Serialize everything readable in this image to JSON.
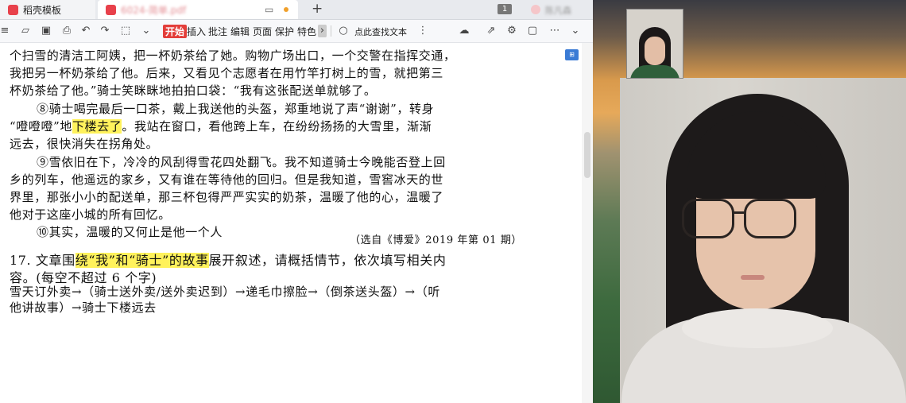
{
  "tabs": [
    {
      "label": "稻壳模板"
    },
    {
      "label": "6024-简单.pdf"
    }
  ],
  "tab_extras": {
    "page_badge": "1",
    "user_name": "陈凡森"
  },
  "toolbar": {
    "menus": [
      "开始",
      "插入",
      "批注",
      "编辑",
      "页面",
      "保护",
      "特色"
    ],
    "search_label": "点此查找文本"
  },
  "document": {
    "lines": [
      "个扫雪的清洁工阿姨，把一杯奶茶给了她。购物广场出口，一个交警在指挥交通，",
      "我把另一杯奶茶给了他。后来，又看见个志愿者在用竹竿打树上的雪，就把第三",
      "杯奶茶给了他。”骑士笑眯眯地拍拍口袋：“我有这张配送单就够了。",
      "“噔噔噔”地",
      "下楼去了",
      "。我站在窗口，看他跨上车，在纷纷扬扬的大雪里，渐渐",
      "远去，很快消失在拐角处。",
      "⑨雪依旧在下，冷冷的风刮得雪花四处翻飞。我不知道骑士今晚能否登上回",
      "乡的列车，他遥远的家乡，又有谁在等待他的回归。但是我知道，雪窖冰天的世",
      "界里，那张小小的配送单，那三杯包得严严实实的奶茶，温暖了他的心，温暖了",
      "他对于这座小城的所有回忆。",
      "⑩其实，温暖的又何止是他一个人",
      "（选自《博爱》2019 年第 01 期）"
    ],
    "para8": "⑧骑士喝完最后一口茶，戴上我送他的头盔，郑重地说了声“谢谢”，转身",
    "q17_prefix": "17. 文章围",
    "q17_highlight": "绕“我”和“骑士”的故事",
    "q17_suffix": "展开叙述，请概括情节，依次填写相关内",
    "q17_line2": "容。(每空不超过 6 个字)",
    "answer_line1": "雪天订外卖→（骑士送外卖/送外卖迟到）→递毛巾擦脸→（倒茶送头盔）→（听",
    "answer_line2": "他讲故事）→骑士下楼远去"
  }
}
